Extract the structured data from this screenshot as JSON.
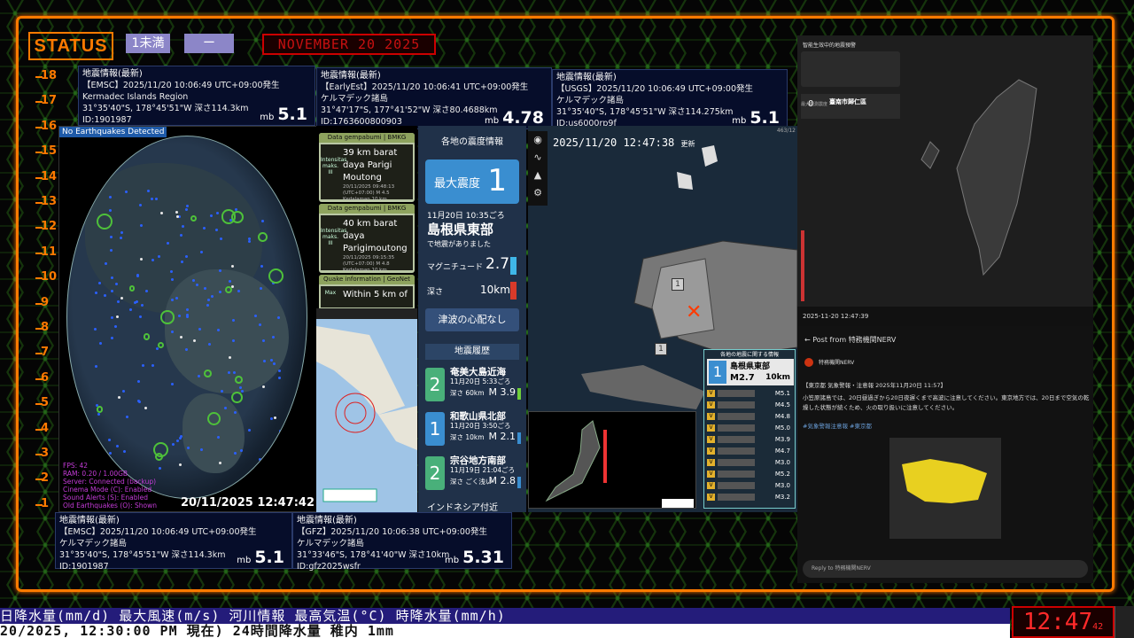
{
  "status_label": "STATUS",
  "level_label": "1未満",
  "dash_label": "ー",
  "date_banner": "NOVEMBER 20 2025",
  "scale": [
    "18",
    "17",
    "16",
    "15",
    "14",
    "13",
    "12",
    "11",
    "10",
    "9",
    "8",
    "7",
    "6",
    "5",
    "4",
    "3",
    "2",
    "1"
  ],
  "quakes": {
    "emsc_top": {
      "header": "地震情報(最新)",
      "line1": "【EMSC】2025/11/20 10:06:49 UTC+09:00発生",
      "line2": "Kermadec Islands Region",
      "line3": "31°35'40\"S, 178°45'51\"W 深さ114.3km",
      "line4": "ID:1901987",
      "mb": "mb",
      "mag": "5.1"
    },
    "earlyest": {
      "header": "地震情報(最新)",
      "line1": "【EarlyEst】2025/11/20 10:06:41 UTC+09:00発生",
      "line2": "ケルマデック諸島",
      "line3": "31°47'17\"S, 177°41'52\"W 深さ80.4688km",
      "line4": "ID:1763600800903",
      "mb": "mb",
      "mag": "4.78"
    },
    "usgs": {
      "header": "地震情報(最新)",
      "line1": "【USGS】2025/11/20 10:06:49 UTC+09:00発生",
      "line2": "ケルマデック諸島",
      "line3": "31°35'40\"S, 178°45'51\"W 深さ114.275km",
      "line4": "ID:us6000rp9f",
      "mb": "mb",
      "mag": "5.1"
    },
    "emsc_bottom": {
      "header": "地震情報(最新)",
      "line1": "【EMSC】2025/11/20 10:06:49 UTC+09:00発生",
      "line2": "ケルマデック諸島",
      "line3": "31°35'40\"S, 178°45'51\"W 深さ114.3km",
      "line4": "ID:1901987",
      "mb": "mb",
      "mag": "5.1"
    },
    "gfz": {
      "header": "地震情報(最新)",
      "line1": "【GFZ】2025/11/20 10:06:38 UTC+09:00発生",
      "line2": "ケルマデック諸島",
      "line3": "31°33'46\"S, 178°41'40\"W 深さ10km",
      "line4": "ID:gfz2025wsfr",
      "mb": "mb",
      "mag": "5.31"
    }
  },
  "globe": {
    "no_eq": "No Earthquakes Detected",
    "timestamp": "20/11/2025 12:47:42",
    "stats": [
      "FPS: 42",
      "RAM: 0.20 / 1.00GB",
      "Server: Connected (backup)",
      "Cinema Mode (C): Enabled",
      "Sound Alerts (S): Enabled",
      "Old Earthquakes (O): Shown"
    ]
  },
  "bmkg": {
    "card1": {
      "title": "Data gempabumi | BMKG",
      "side": "Intensitas maks. III",
      "main": "39 km barat daya Parigi Moutong",
      "small": "20/11/2025 09:48:13 (UTC+07:00) M 4.5 Kedalaman 10 km"
    },
    "card2": {
      "title": "Data gempabumi | BMKG",
      "side": "Intensitas maks. III",
      "main": "40 km barat daya Parigimoutong",
      "small": "20/11/2025 09:15:35 (UTC+07:00) M 4.8 Kedalaman 10 km"
    },
    "card3": {
      "title": "Quake information | GeoNet",
      "side": "Max",
      "main": "Within 5 km of"
    }
  },
  "jma": {
    "caption": "各地の震度情報",
    "max_label": "最大震度",
    "max_value": "1",
    "date": "11月20日 10:35ごろ",
    "place": "島根県東部",
    "occurred": "で地震がありました",
    "mag_label": "マグニチュード",
    "mag_value": "2.7",
    "depth_label": "深さ",
    "depth_value": "10km",
    "tsunami": "津波の心配なし",
    "history_title": "地震履歴",
    "history": [
      {
        "int": "2",
        "name": "奄美大島近海",
        "date": "11月20日 5:33ごろ",
        "depth": "深さ 60km",
        "mag": "M 3.9",
        "bar": "#6fcf3a",
        "box": "green"
      },
      {
        "int": "1",
        "name": "和歌山県北部",
        "date": "11月20日 3:50ごろ",
        "depth": "深さ 10km",
        "mag": "M 2.1",
        "bar": "#3a8ed0",
        "box": "blue"
      },
      {
        "int": "2",
        "name": "宗谷地方南部",
        "date": "11月19日 21:04ごろ",
        "depth": "深さ ごく浅い",
        "mag": "M 2.8",
        "bar": "#3a8ed0",
        "box": "green"
      }
    ],
    "footer": "インドネシア付近"
  },
  "japan_map": {
    "timestamp": "2025/11/20 12:47:38",
    "suffix": "更新",
    "counter": "463/12"
  },
  "region_list": {
    "title": "各地の地震に関する情報",
    "head_int": "1",
    "head_name": "島根県東部",
    "head_mag": "M2.7",
    "head_depth": "10km",
    "mags": [
      "M5.1",
      "M4.5",
      "M4.8",
      "M5.0",
      "M3.9",
      "M4.7",
      "M3.0",
      "M5.2",
      "M3.0",
      "M3.2"
    ],
    "ints": [
      "V",
      "V",
      "V",
      "V",
      "V",
      "V",
      "V",
      "V",
      "V",
      "V"
    ]
  },
  "taiwan": {
    "title": "智能生效中的地震預警",
    "station": "臺南市歸仁區",
    "max_label": "最大觀測震度",
    "max_value": "0",
    "timestamp": "2025-11-20 12:47:39"
  },
  "nerv": {
    "back": "← Post from 特務機関NERV",
    "user": "特務機関NERV",
    "body": "【東京都 気象警報・注意報 2025年11月20日 11:57】",
    "body2": "小笠原諸島では、20日昼過ぎから20日夜遅くまで高波に注意してください。東京地方では、20日まで空気の乾燥した状態が続くため、火の取り扱いに注意してください。",
    "tags": "#気象警報注意報 #東京都",
    "reply": "Reply to 特務機関NERV"
  },
  "ticker1": "日降水量(mm/d) 最大風速(m/s) 河川情報 最高気温(°C) 時降水量(mm/h)",
  "ticker2": "20/2025, 12:30:00 PM 現在) 24時間降水量 稚内 1mm",
  "clock": "12:47",
  "clock_suffix": "42"
}
